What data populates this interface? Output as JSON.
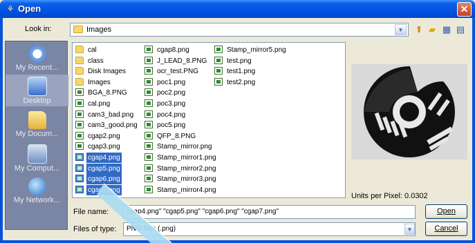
{
  "window": {
    "title": "Open",
    "close_glyph": "✕",
    "title_icon": "app-icon"
  },
  "lookin": {
    "label": "Look in:",
    "value": "Images",
    "toolbar": [
      "up-one-level-icon",
      "new-folder-icon",
      "list-view-icon",
      "details-view-icon"
    ]
  },
  "places": [
    {
      "label": "My Recent...",
      "icon": "recent-documents-icon"
    },
    {
      "label": "Desktop",
      "icon": "desktop-icon"
    },
    {
      "label": "My Docum...",
      "icon": "my-documents-icon"
    },
    {
      "label": "My Comput...",
      "icon": "my-computer-icon"
    },
    {
      "label": "My Network...",
      "icon": "my-network-icon"
    }
  ],
  "files": {
    "col1": [
      {
        "name": "cal",
        "type": "folder"
      },
      {
        "name": "class",
        "type": "folder"
      },
      {
        "name": "Disk Images",
        "type": "folder"
      },
      {
        "name": "Images",
        "type": "folder"
      },
      {
        "name": "BGA_8.PNG",
        "type": "png"
      },
      {
        "name": "cal.png",
        "type": "png"
      },
      {
        "name": "cam3_bad.png",
        "type": "png"
      },
      {
        "name": "cam3_good.png",
        "type": "png"
      },
      {
        "name": "cgap2.png",
        "type": "png"
      },
      {
        "name": "cgap3.png",
        "type": "png"
      },
      {
        "name": "cgap4.png",
        "type": "png",
        "selected": true
      },
      {
        "name": "cgap5.png",
        "type": "png",
        "selected": true
      },
      {
        "name": "cgap6.png",
        "type": "png",
        "selected": true
      },
      {
        "name": "cgap7.png",
        "type": "png",
        "selected": true
      }
    ],
    "col2": [
      {
        "name": "cgap8.png",
        "type": "png"
      },
      {
        "name": "J_LEAD_8.PNG",
        "type": "png"
      },
      {
        "name": "ocr_test.PNG",
        "type": "png"
      },
      {
        "name": "poc1.png",
        "type": "png"
      },
      {
        "name": "poc2.png",
        "type": "png"
      },
      {
        "name": "poc3.png",
        "type": "png"
      },
      {
        "name": "poc4.png",
        "type": "png"
      },
      {
        "name": "poc5.png",
        "type": "png"
      },
      {
        "name": "QFP_8.PNG",
        "type": "png"
      },
      {
        "name": "Stamp_mirror.png",
        "type": "png"
      },
      {
        "name": "Stamp_mirror1.png",
        "type": "png"
      },
      {
        "name": "Stamp_mirror2.png",
        "type": "png"
      },
      {
        "name": "Stamp_mirror3.png",
        "type": "png"
      },
      {
        "name": "Stamp_mirror4.png",
        "type": "png"
      }
    ],
    "col3": [
      {
        "name": "Stamp_mirror5.png",
        "type": "png"
      },
      {
        "name": "test.png",
        "type": "png"
      },
      {
        "name": "test1.png",
        "type": "png"
      },
      {
        "name": "test2.png",
        "type": "png"
      }
    ]
  },
  "preview": {
    "units_text": "Units per Pixel: 0.0302"
  },
  "filename": {
    "label": "File name:",
    "value": "cgap4.png\" \"cgap5.png\" \"cgap6.png\" \"cgap7.png\""
  },
  "filetype": {
    "label": "Files of type:",
    "value": "PNG files (.png)"
  },
  "buttons": {
    "open": "Open",
    "cancel": "Cancel"
  },
  "colors": {
    "titlebar": "#0054e3",
    "selection": "#316ac5",
    "places_bar": "#7b86a4",
    "callout": "#a9dcf2"
  }
}
